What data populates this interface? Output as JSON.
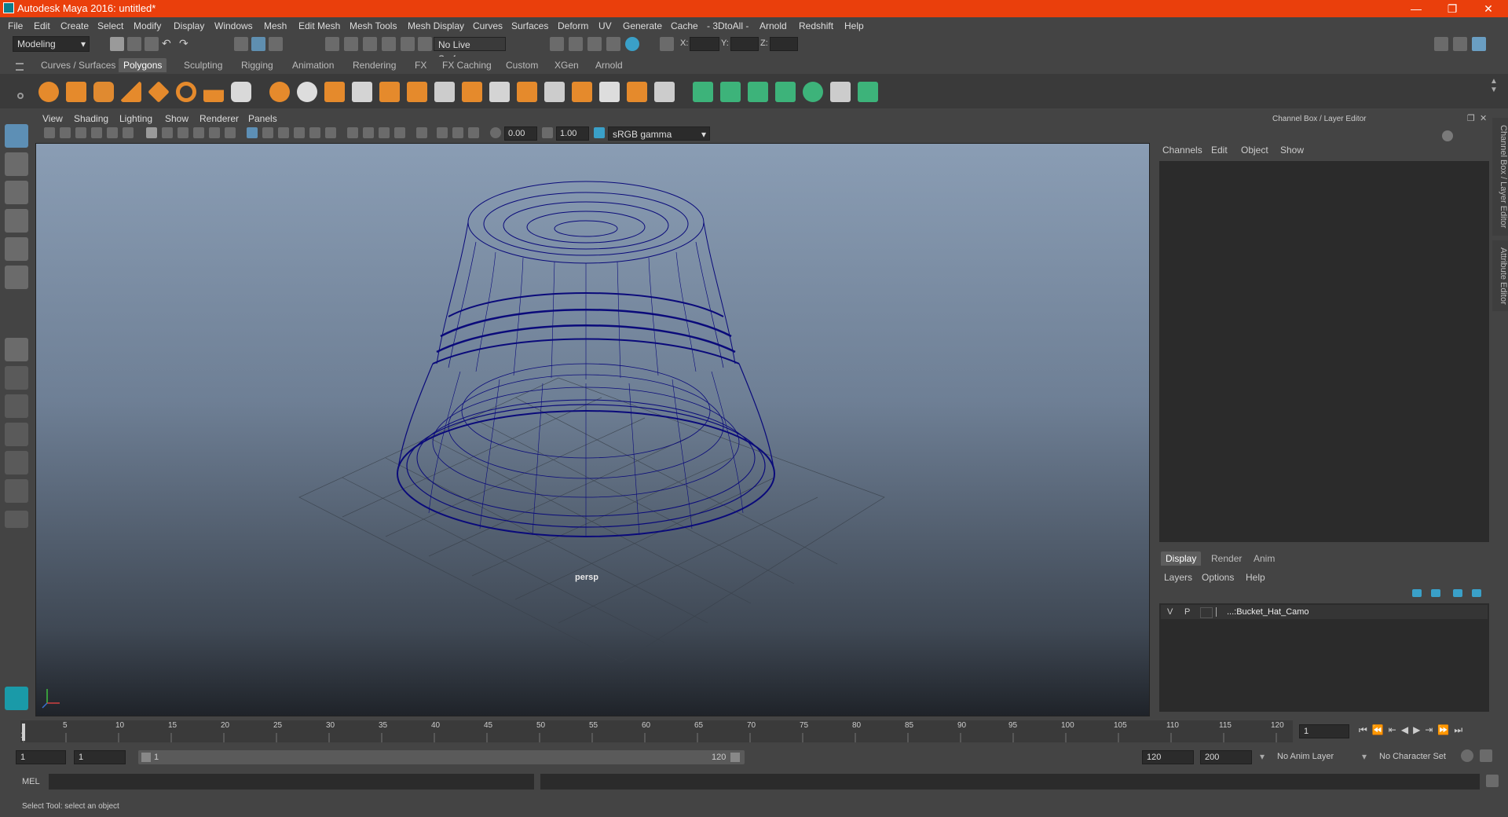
{
  "title": "Autodesk Maya 2016: untitled*",
  "window_buttons": [
    "—",
    "❐",
    "✕"
  ],
  "menus": [
    "File",
    "Edit",
    "Create",
    "Select",
    "Modify",
    "Display",
    "Windows",
    "Mesh",
    "Edit Mesh",
    "Mesh Tools",
    "Mesh Display",
    "Curves",
    "Surfaces",
    "Deform",
    "UV",
    "Generate",
    "Cache",
    "- 3DtoAll -",
    "Arnold",
    "Redshift",
    "Help"
  ],
  "status": {
    "mode": "Modeling",
    "live_surface": "No Live Surface",
    "x_label": "X:",
    "y_label": "Y:",
    "z_label": "Z:"
  },
  "shelf_tabs": [
    "Curves / Surfaces",
    "Polygons",
    "Sculpting",
    "Rigging",
    "Animation",
    "Rendering",
    "FX",
    "FX Caching",
    "Custom",
    "XGen",
    "Arnold"
  ],
  "active_shelf": "Polygons",
  "viewport": {
    "menus": [
      "View",
      "Shading",
      "Lighting",
      "Show",
      "Renderer",
      "Panels"
    ],
    "exposure": "0.00",
    "gamma": "1.00",
    "color_space": "sRGB gamma",
    "camera": "persp"
  },
  "channel_box": {
    "title": "Channel Box / Layer Editor",
    "menus": [
      "Channels",
      "Edit",
      "Object",
      "Show"
    ],
    "side_tabs": [
      "Channel Box / Layer Editor",
      "Attribute Editor"
    ]
  },
  "layer_editor": {
    "tabs": [
      "Display",
      "Render",
      "Anim"
    ],
    "active_tab": "Display",
    "menus": [
      "Layers",
      "Options",
      "Help"
    ],
    "layer": {
      "v": "V",
      "p": "P",
      "name": "...:Bucket_Hat_Camo"
    }
  },
  "timeline": {
    "ticks": [
      "1",
      "5",
      "10",
      "15",
      "20",
      "25",
      "30",
      "35",
      "40",
      "45",
      "50",
      "55",
      "60",
      "65",
      "70",
      "75",
      "80",
      "85",
      "90",
      "95",
      "100",
      "105",
      "110",
      "115",
      "120"
    ],
    "current_frame": "1"
  },
  "range": {
    "start": "1",
    "inner_start": "1",
    "slider_start": "1",
    "slider_end": "120",
    "end": "120",
    "max_end": "200",
    "anim_layer": "No Anim Layer",
    "character_set": "No Character Set"
  },
  "command_line": {
    "label": "MEL"
  },
  "help_line": "Select Tool: select an object",
  "colors": {
    "title_bar": "#ea3f0c",
    "wireframe": "#0a0a7a",
    "panel": "#444444",
    "field": "#2b2b2b"
  }
}
